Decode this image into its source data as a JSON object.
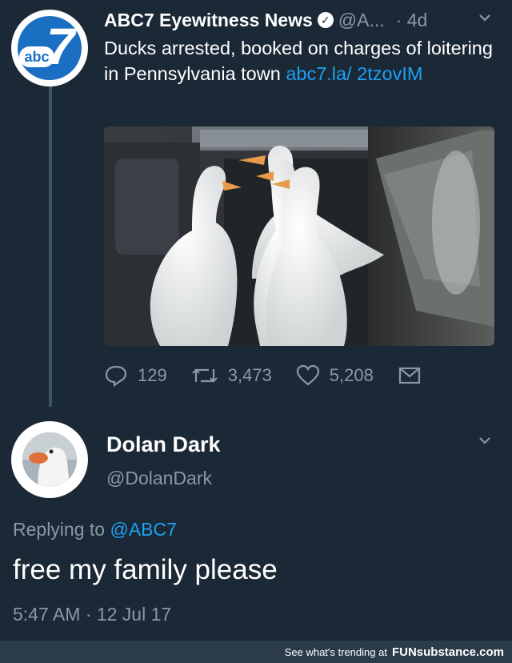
{
  "tweet1": {
    "display_name": "ABC7 Eyewitness News",
    "handle": "@A...",
    "time": "· 4d",
    "text_main": "Ducks arrested, booked on charges of loitering in Pennsylvania town ",
    "link": "abc7.la/ 2tzovIM",
    "avatar_badge": "abc",
    "avatar_number": "7",
    "actions": {
      "replies": "129",
      "retweets": "3,473",
      "likes": "5,208"
    },
    "icons": {
      "verified": "verified-check-icon",
      "chevron": "chevron-down-icon",
      "reply": "reply-bubble-icon",
      "retweet": "retweet-icon",
      "like": "heart-icon",
      "dm": "envelope-icon"
    }
  },
  "tweet2": {
    "display_name": "Dolan Dark",
    "handle": "@DolanDark",
    "replying_prefix": "Replying to ",
    "replying_to": "@ABC7",
    "text": "free my family please",
    "timestamp": "5:47 AM · 12 Jul 17"
  },
  "footer": {
    "text": "See what's trending at",
    "brand": "FUNsubstance.com"
  },
  "colors": {
    "background": "#1b2836",
    "text": "#ffffff",
    "muted": "#8899a6",
    "link": "#1da1f2",
    "abc_blue": "#1b6fc2"
  }
}
